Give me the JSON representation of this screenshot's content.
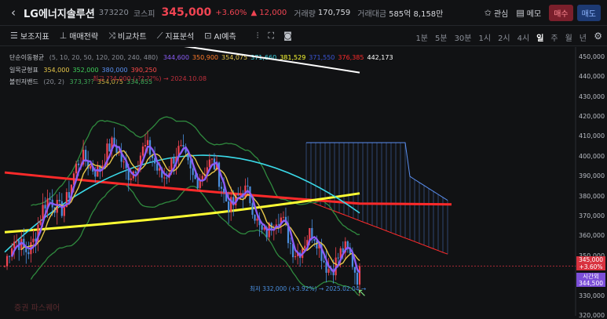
{
  "header": {
    "back_icon": "chevron-left-icon",
    "name": "LG에너지솔루션",
    "code": "373220",
    "market": "코스피",
    "price": "345,000",
    "change_pct": "+3.60%",
    "change_abs": "▲ 12,000",
    "volume_label": "거래량",
    "volume_value": "170,759",
    "amount_label": "거래대금",
    "amount_value": "585억 8,158만",
    "watch_label": "관심",
    "memo_label": "메모",
    "buy_label": "매수",
    "sell_label": "매도"
  },
  "toolbar": {
    "tools": [
      {
        "icon": "sliders-icon",
        "label": "보조지표"
      },
      {
        "icon": "trade-strategy-icon",
        "label": "매매전략"
      },
      {
        "icon": "compare-icon",
        "label": "비교차트"
      },
      {
        "icon": "indicator-analysis-icon",
        "label": "지표분석"
      },
      {
        "icon": "ai-icon",
        "label": "AI예측"
      }
    ],
    "periods": [
      "1분",
      "5분",
      "30분",
      "1시",
      "2시",
      "4시",
      "일",
      "주",
      "월",
      "년"
    ],
    "active_period": "일"
  },
  "legend": {
    "ma": {
      "label": "단순이동평균",
      "params": "(5, 10, 20, 50, 120, 200, 240, 480)",
      "values": [
        "344,600",
        "350,900",
        "354,075",
        "371,660",
        "381,529",
        "371,550",
        "376,385",
        "442,173"
      ],
      "colors": [
        "#8a5cf6",
        "#ff7a29",
        "#e8c84a",
        "#3ad9e8",
        "#ffff33",
        "#3b55d6",
        "#ff2a2a",
        "#ffffff"
      ]
    },
    "ichimoku": {
      "label": "일목균형표",
      "values": [
        "354,000",
        "352,000",
        "380,000",
        "390,250"
      ],
      "colors": [
        "#e8c84a",
        "#3fcf5a",
        "#5a8ff0",
        "#ff4a4a"
      ]
    },
    "bollinger": {
      "label": "볼린저밴드",
      "params": "(20, 2)",
      "values": [
        "373,3??",
        "354,075",
        "334,855"
      ],
      "colors": [
        "#3fae5a",
        "#c8b040",
        "#3fae5a"
      ]
    },
    "annotation": "최고 ??4,000 (-??.??%) → 2024.10.08"
  },
  "chart_data": {
    "type": "candlestick",
    "y_ticks": [
      "450,000",
      "440,000",
      "430,000",
      "420,000",
      "410,000",
      "400,000",
      "390,000",
      "380,000",
      "370,000",
      "360,000",
      "350,000",
      "340,000",
      "330,000",
      "320,000"
    ],
    "ylim": [
      320000,
      455000
    ],
    "last_price": 345000,
    "last_price_label": "345,000",
    "last_change_label": "+3.60%",
    "countdown_label": "시간외",
    "countdown_value": "344,500",
    "low_annotation": "최저 332,000 (+3.92%) → 2025.02.04 →",
    "high_annotation": "최고 ??4,000 (-??.??%) → 2024.10.08",
    "watermark": "증권 파스퀘어",
    "colors": {
      "up": "#f04452",
      "down": "#4a8fdf",
      "ma5": "#8a5cf6",
      "ma20": "#e8c84a",
      "ma50": "#3ad9e8",
      "ma120": "#ffff33",
      "ma240": "#ff2a2a",
      "ma480": "#ffffff",
      "boll": "#2f8a3e",
      "cloud": "#5a8ff0",
      "span_red": "#ff2a2a"
    }
  }
}
